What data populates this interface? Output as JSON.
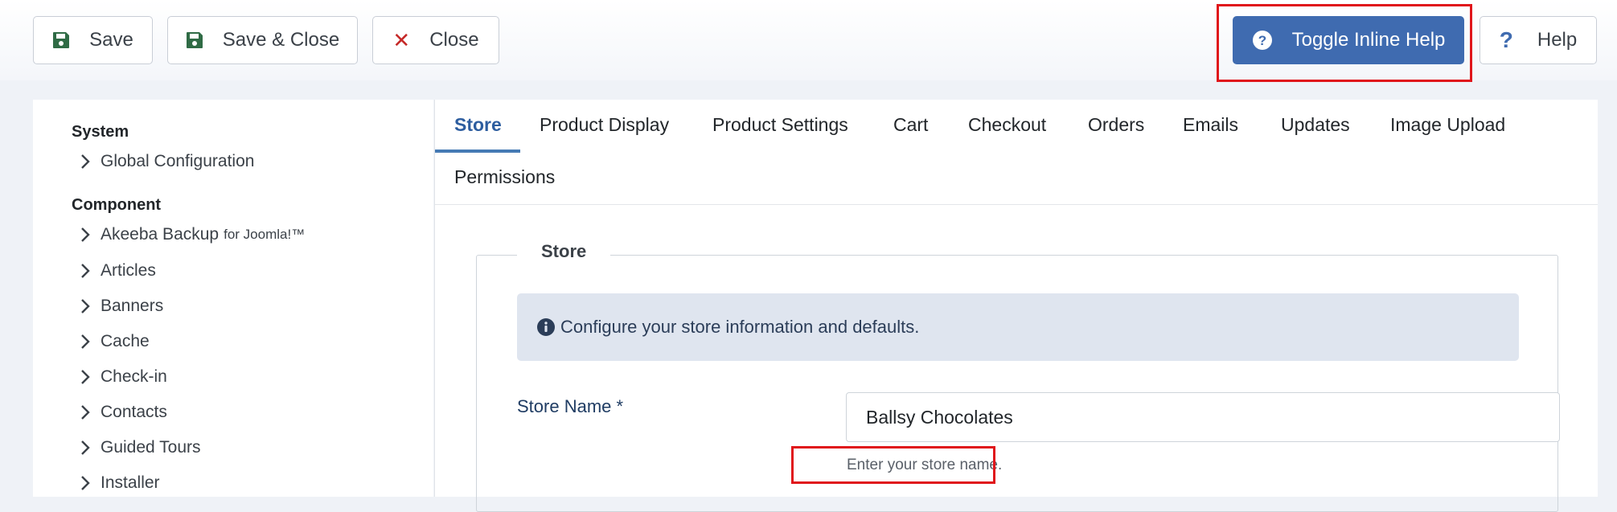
{
  "toolbar": {
    "save_label": "Save",
    "save_close_label": "Save & Close",
    "close_label": "Close",
    "toggle_help_label": "Toggle Inline Help",
    "help_label": "Help"
  },
  "sidebar": {
    "system_heading": "System",
    "system_items": [
      {
        "label": "Global Configuration"
      }
    ],
    "component_heading": "Component",
    "component_items": [
      {
        "label": "Akeeba Backup",
        "suffix": "for Joomla!™"
      },
      {
        "label": "Articles"
      },
      {
        "label": "Banners"
      },
      {
        "label": "Cache"
      },
      {
        "label": "Check-in"
      },
      {
        "label": "Contacts"
      },
      {
        "label": "Guided Tours"
      },
      {
        "label": "Installer"
      }
    ]
  },
  "tabs": [
    {
      "label": "Store"
    },
    {
      "label": "Product Display"
    },
    {
      "label": "Product Settings"
    },
    {
      "label": "Cart"
    },
    {
      "label": "Checkout"
    },
    {
      "label": "Orders"
    },
    {
      "label": "Emails"
    },
    {
      "label": "Updates"
    },
    {
      "label": "Image Upload"
    },
    {
      "label": "Permissions"
    }
  ],
  "store": {
    "legend": "Store",
    "info_text": "Configure your store information and defaults.",
    "store_name_label": "Store Name *",
    "store_name_value": "Ballsy Chocolates",
    "store_name_help": "Enter your store name."
  },
  "colors": {
    "primary": "#3f6bb0",
    "danger": "#c52827",
    "highlight": "#e0161b",
    "save_icon": "#2f6b45"
  },
  "icons": {
    "save": "floppy-disk-icon",
    "close": "close-x-icon",
    "toggle_help": "question-circle-icon",
    "help": "question-mark-icon",
    "info": "info-circle-icon",
    "chevron": "chevron-right-icon"
  }
}
